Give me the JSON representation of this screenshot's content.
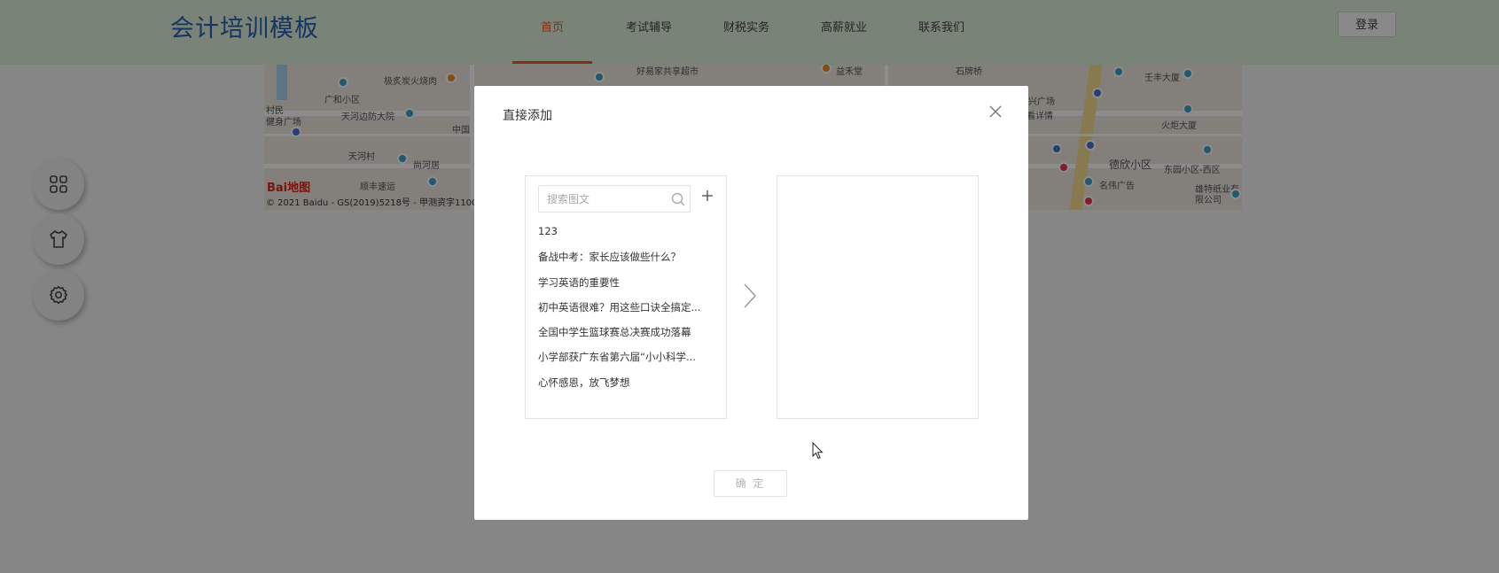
{
  "header": {
    "logo": "会计培训模板",
    "nav": [
      {
        "label": "首页",
        "active": true
      },
      {
        "label": "考试辅导",
        "active": false
      },
      {
        "label": "财税实务",
        "active": false
      },
      {
        "label": "高薪就业",
        "active": false
      },
      {
        "label": "联系我们",
        "active": false
      }
    ],
    "login_label": "登录"
  },
  "map": {
    "labels": [
      "极炙炭火烧肉",
      "好易家共享超市",
      "益禾堂",
      "石牌桥",
      "壬丰大厦",
      "广和小区",
      "天河边防大院",
      "兴广场",
      "看详情",
      "火炬大厦",
      "天河村",
      "尚河居",
      "中国",
      "德欣小区",
      "东园小区-西区",
      "顺丰速运",
      "名伟广告",
      "雄特纸业有限公司",
      "村民",
      "健身广场"
    ],
    "baidu_logo": "Bai地图",
    "copyright": "© 2021 Baidu - GS(2019)5218号 - 甲测资字1100"
  },
  "side_buttons": [
    "apps-icon",
    "tshirt-icon",
    "settings-icon"
  ],
  "modal": {
    "title": "直接添加",
    "search_placeholder": "搜索图文",
    "left_list": [
      "123",
      "备战中考：家长应该做些什么？",
      "学习英语的重要性",
      "初中英语很难？用这些口诀全搞定...",
      "全国中学生篮球赛总决赛成功落幕",
      "小学部获广东省第六届“小小科学...",
      "心怀感恩，放飞梦想"
    ],
    "right_list": [],
    "confirm_label": "确 定"
  },
  "colors": {
    "header_bg": "#dfefd9",
    "logo": "#2a62b5",
    "nav_active": "#e85c2b",
    "overlay": "rgba(0,0,0,0.45)"
  }
}
